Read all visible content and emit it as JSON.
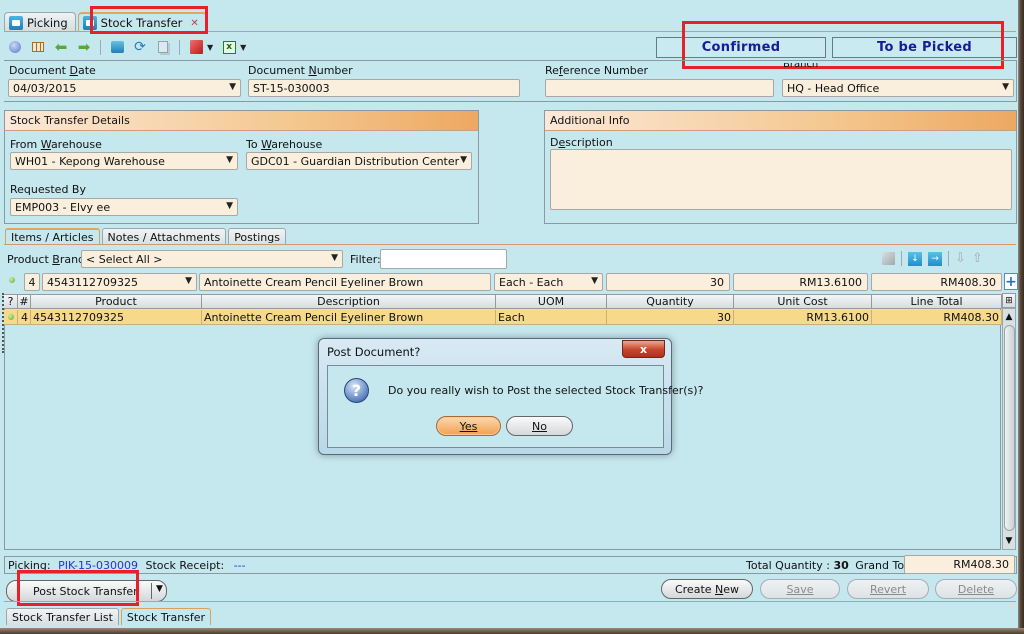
{
  "tabs": [
    {
      "label": "Picking",
      "icon": "picking-icon",
      "active": false
    },
    {
      "label": "Stock Transfer",
      "icon": "stock-transfer-icon",
      "active": true,
      "closable": true
    }
  ],
  "toolbar": {
    "icons": [
      "help-icon",
      "grid-icon",
      "back-arrow-icon",
      "forward-arrow-icon",
      "print-icon",
      "refresh-icon",
      "copy-icon",
      "pdf-icon",
      "excel-icon"
    ]
  },
  "status": {
    "state": "Confirmed",
    "picking_state": "To be Picked"
  },
  "header": {
    "document_date_label": "Document Date",
    "document_date": "04/03/2015",
    "document_number_label": "Document Number",
    "document_number": "ST-15-030003",
    "reference_number_label": "Reference Number",
    "reference_number": "",
    "branch_label": "Branch",
    "branch": "HQ - Head Office"
  },
  "details": {
    "title": "Stock Transfer Details",
    "from_warehouse_label": "From Warehouse",
    "from_warehouse": "WH01 - Kepong Warehouse",
    "to_warehouse_label": "To Warehouse",
    "to_warehouse": "GDC01 - Guardian Distribution Center",
    "requested_by_label": "Requested By",
    "requested_by": "EMP003 - Elvy ee"
  },
  "additional": {
    "title": "Additional Info",
    "description_label": "Description",
    "description": ""
  },
  "inner_tabs": [
    {
      "label": "Items / Articles",
      "active": true
    },
    {
      "label": "Notes / Attachments",
      "active": false
    },
    {
      "label": "Postings",
      "active": false
    }
  ],
  "filters": {
    "product_brand_label": "Product Brand:",
    "product_brand": "< Select All >",
    "filter_label": "Filter:",
    "filter_value": ""
  },
  "grid_tools": [
    "edit-disabled-icon",
    "csv-import-icon",
    "csv-export-icon",
    "move-down-icon",
    "move-up-icon"
  ],
  "entry_row": {
    "line": "4",
    "product": "4543112709325",
    "description": "Antoinette Cream Pencil Eyeliner Brown",
    "uom": "Each - Each",
    "quantity": "30",
    "unit_cost": "RM13.6100",
    "line_total": "RM408.30"
  },
  "grid": {
    "columns": [
      "?",
      "#",
      "Product",
      "Description",
      "UOM",
      "Quantity",
      "Unit Cost",
      "Line Total"
    ],
    "rows": [
      {
        "line": "4",
        "product": "4543112709325",
        "description": "Antoinette Cream Pencil Eyeliner Brown",
        "uom": "Each",
        "quantity": "30",
        "unit_cost": "RM13.6100",
        "line_total": "RM408.30"
      }
    ]
  },
  "dialog": {
    "title": "Post Document?",
    "message": "Do you really wish to Post the selected Stock Transfer(s)?",
    "yes_label": "Yes",
    "no_label": "No",
    "close_label": "x"
  },
  "footer": {
    "picking_label": "Picking:",
    "picking_value": "PIK-15-030009",
    "stock_receipt_label": "Stock Receipt:",
    "stock_receipt_value": "---",
    "total_quantity_label": "Total Quantity :",
    "total_quantity": "30",
    "grand_total_label": "Grand Total:",
    "grand_total": "RM408.30"
  },
  "actions": {
    "post_label": "Post Stock Transfer",
    "create_new_label": "Create New",
    "save_label": "Save",
    "revert_label": "Revert",
    "delete_label": "Delete"
  },
  "bottom_tabs": [
    {
      "label": "Stock Transfer List",
      "active": false
    },
    {
      "label": "Stock Transfer",
      "active": true
    }
  ]
}
